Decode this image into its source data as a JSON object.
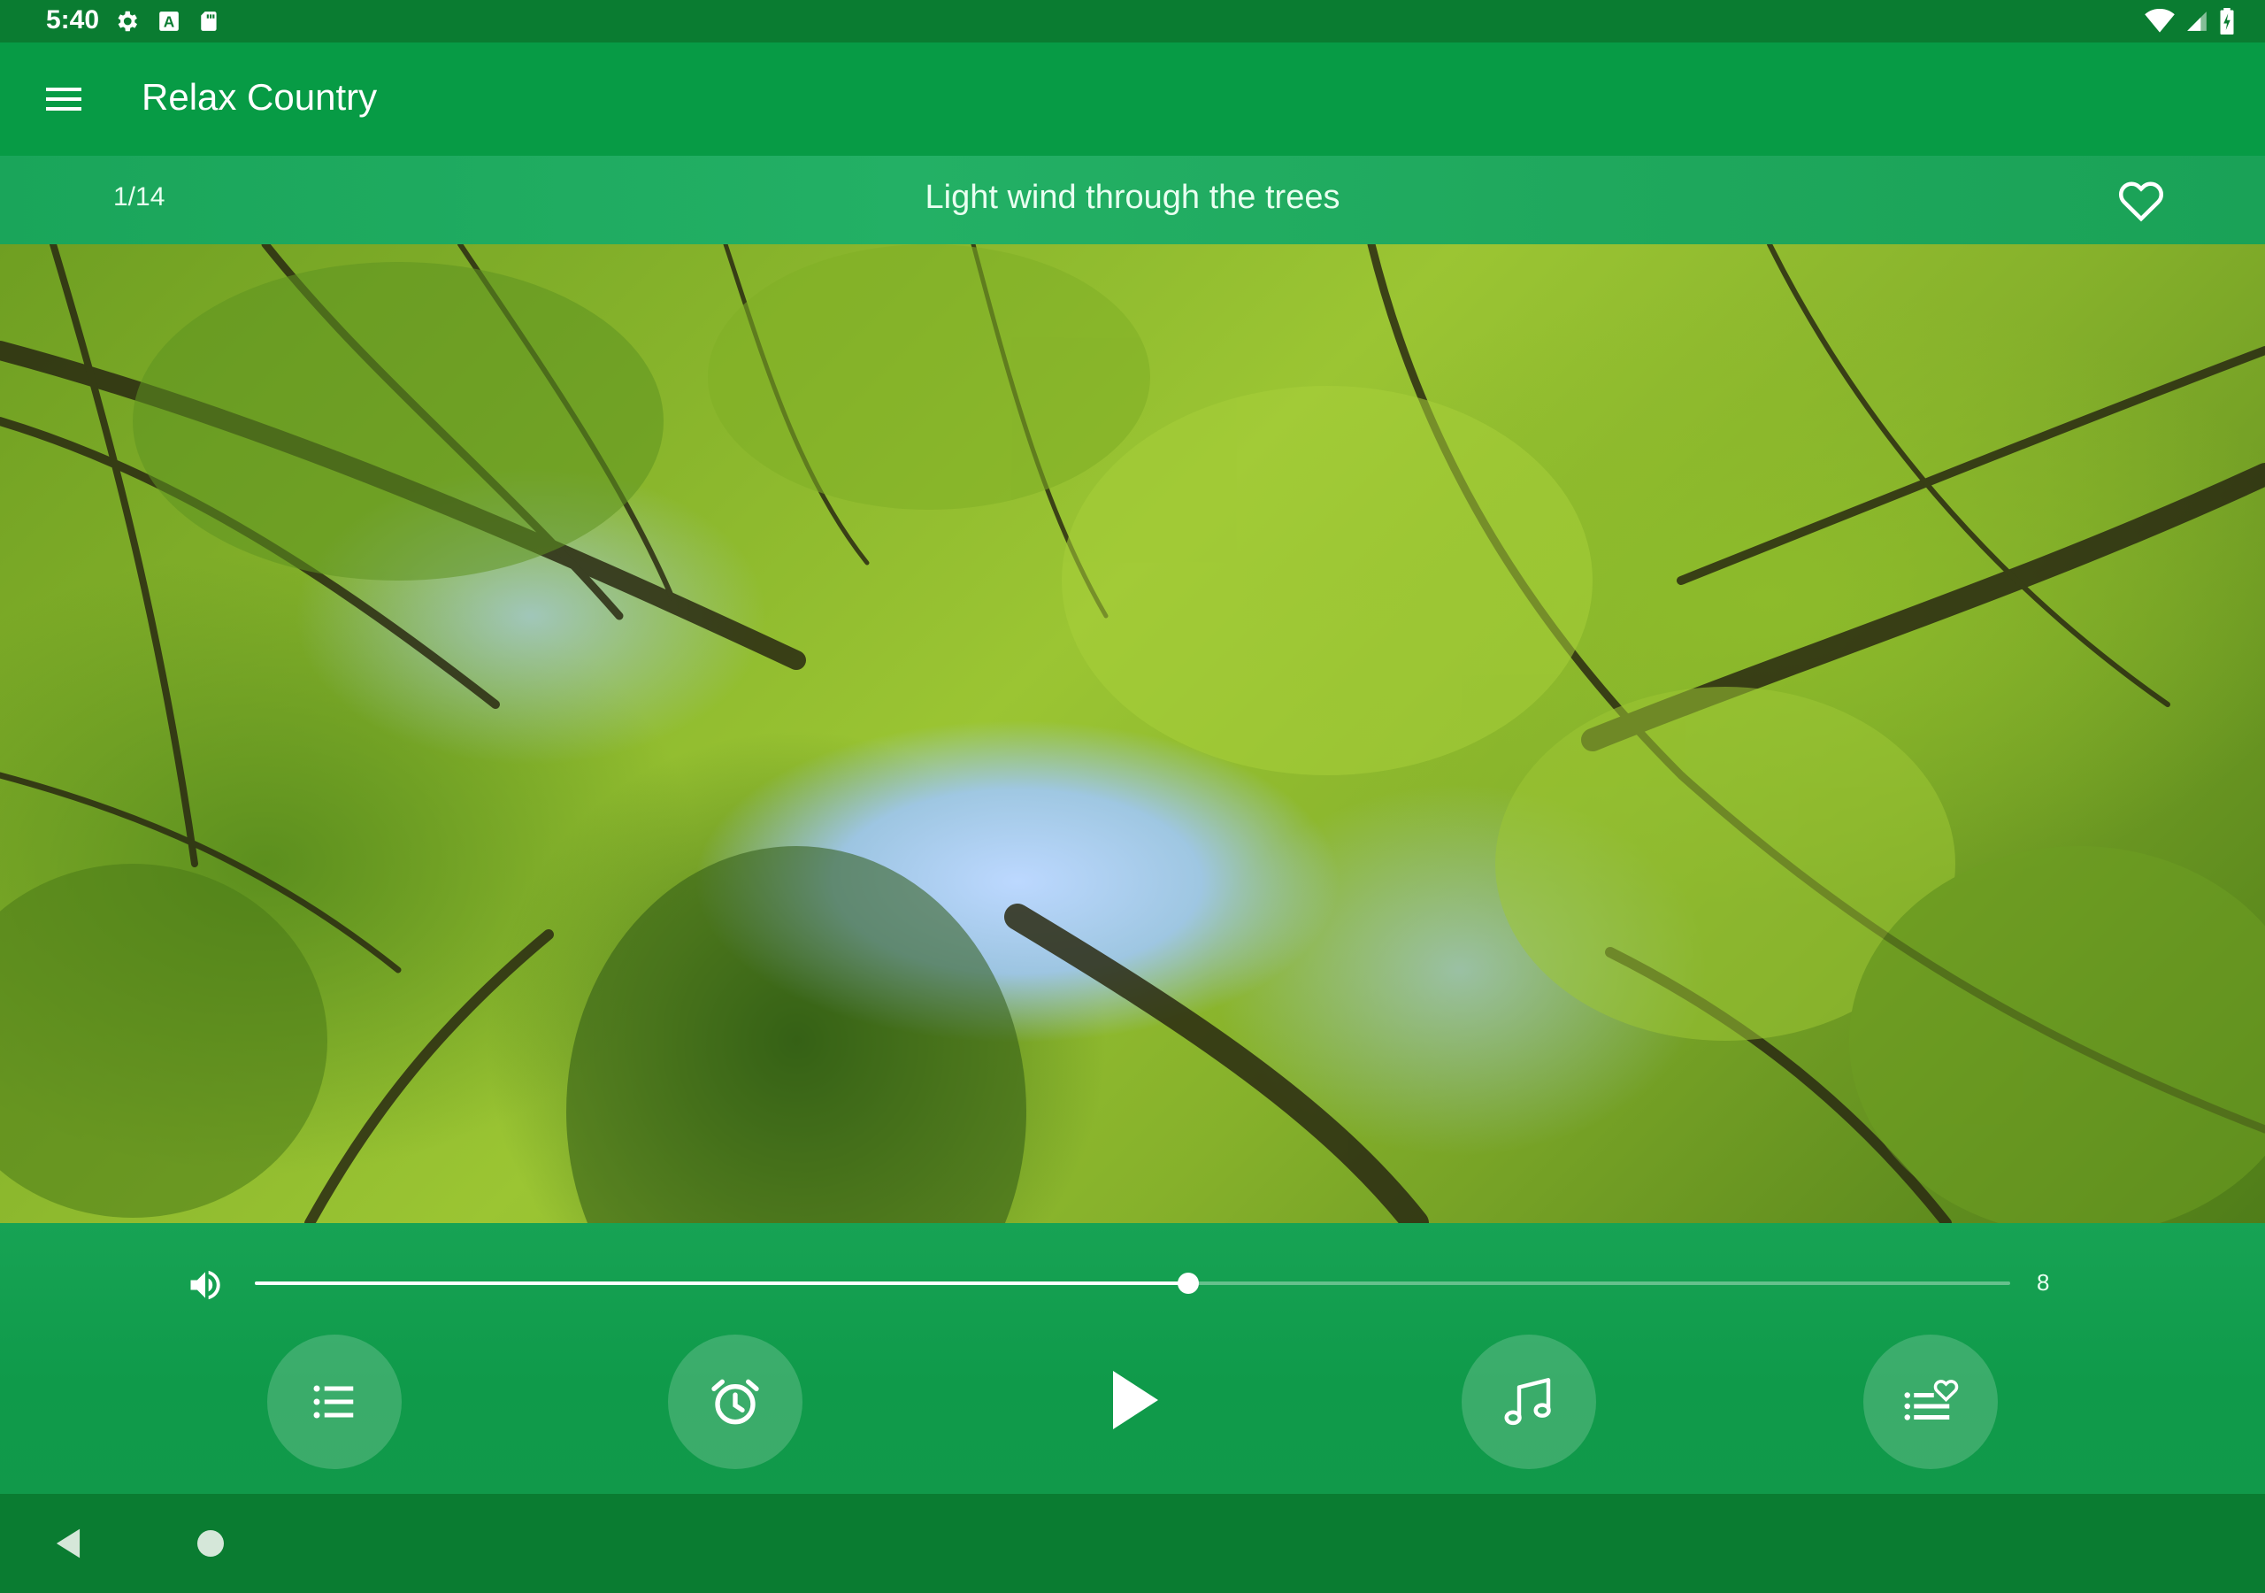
{
  "status_bar": {
    "time": "5:40",
    "icons_left": [
      "gear-icon",
      "a-letter-icon",
      "sd-card-icon"
    ],
    "icons_right": [
      "wifi-icon",
      "cell-signal-icon",
      "battery-charging-icon"
    ]
  },
  "app_bar": {
    "title": "Relax Country",
    "menu_icon": "hamburger-menu-icon",
    "background_color": "#079b45"
  },
  "track": {
    "counter": "1/14",
    "title": "Light wind through the trees",
    "favorite_icon": "heart-outline-icon"
  },
  "volume": {
    "value": "8",
    "level_fraction": 0.532,
    "icon": "volume-up-icon"
  },
  "controls": {
    "buttons": [
      {
        "name": "playlist-button",
        "icon": "list-icon"
      },
      {
        "name": "timer-button",
        "icon": "alarm-clock-icon"
      },
      {
        "name": "play-button",
        "icon": "play-icon"
      },
      {
        "name": "music-button",
        "icon": "music-note-icon"
      },
      {
        "name": "favorites-list-button",
        "icon": "heart-list-icon"
      }
    ]
  },
  "colors": {
    "status_bar": "#0a7c31",
    "accent": "#079b45",
    "panel": "#17a354"
  }
}
